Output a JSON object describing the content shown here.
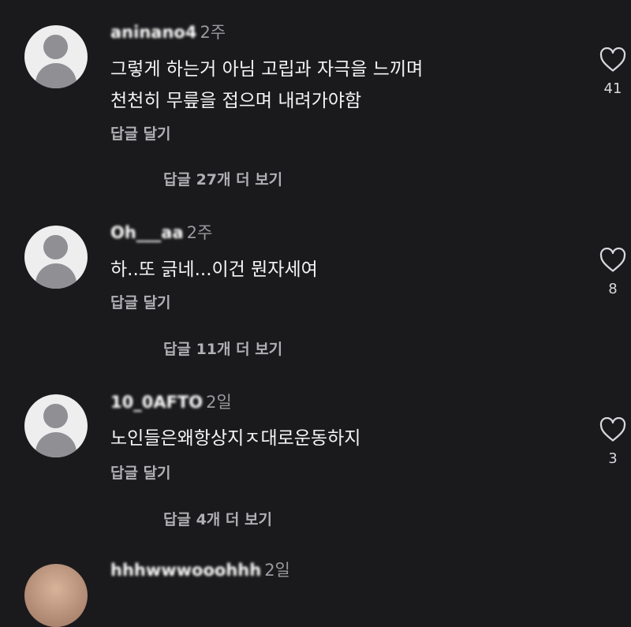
{
  "comments": [
    {
      "username": "aninano4",
      "time": "2주",
      "text": "그렇게 하는거 아님 고립과 자극을 느끼며\n천천히 무릎을 접으며 내려가야함",
      "reply_label": "답글 달기",
      "more_replies": "답글 27개 더 보기",
      "likes": "41"
    },
    {
      "username": "Oh___aa",
      "time": "2주",
      "text": "하..또 긁네...이건 뭔자세여",
      "reply_label": "답글 달기",
      "more_replies": "답글 11개 더 보기",
      "likes": "8"
    },
    {
      "username": "10_0AFTO",
      "time": "2일",
      "text": "노인들은왜항상지ㅈ대로운동하지",
      "reply_label": "답글 달기",
      "more_replies": "답글 4개 더 보기",
      "likes": "3"
    },
    {
      "username": "hhhwwwooohhh",
      "time": "2일"
    }
  ]
}
